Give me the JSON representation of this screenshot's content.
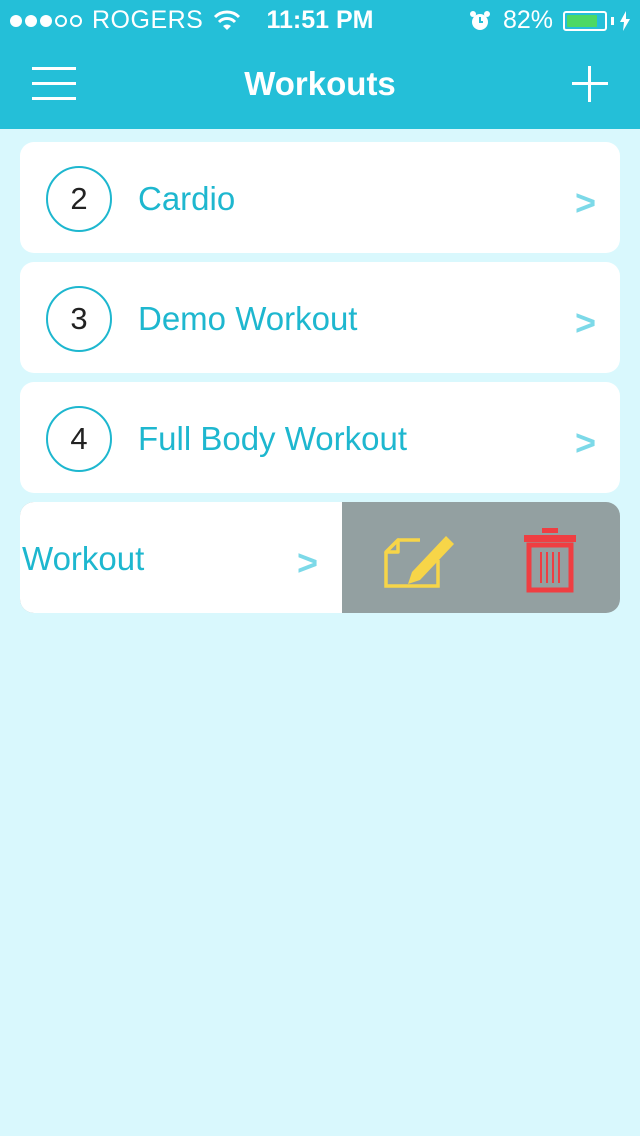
{
  "status_bar": {
    "carrier": "ROGERS",
    "time": "11:51 PM",
    "battery_percent": "82%",
    "battery_level": 0.82,
    "signal_filled": 3,
    "signal_total": 5
  },
  "nav": {
    "title": "Workouts",
    "menu_icon": "hamburger-menu-icon",
    "add_icon": "plus-icon"
  },
  "workouts": [
    {
      "number": "2",
      "name": "Cardio",
      "chevron": ">"
    },
    {
      "number": "3",
      "name": "Demo Workout",
      "chevron": ">"
    },
    {
      "number": "4",
      "name": "Full Body Workout",
      "chevron": ">"
    }
  ],
  "swiped_row": {
    "name_visible": "dy Workout",
    "chevron": ">",
    "edit_icon": "edit-note-icon",
    "delete_icon": "trash-icon"
  },
  "colors": {
    "header": "#24bfd8",
    "background": "#d9f8fd",
    "accent": "#1eb7cf",
    "chevron": "#7cd9e8",
    "swipe_bg": "#93a0a1",
    "edit": "#f7d548",
    "delete": "#ef3e42",
    "battery": "#4cd964"
  }
}
